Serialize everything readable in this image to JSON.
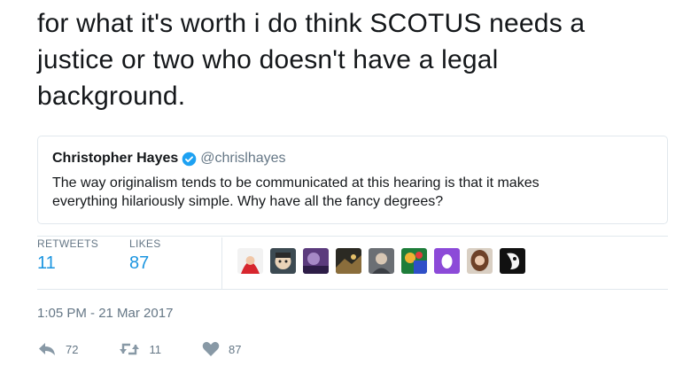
{
  "tweet": {
    "text_lines": [
      "for what it's worth i do think SCOTUS needs a",
      "justice or two who doesn't have a legal",
      "background."
    ]
  },
  "quoted_tweet": {
    "name": "Christopher Hayes",
    "handle": "@chrislhayes",
    "verified_icon": "verified-badge-icon",
    "text_lines": [
      "The way originalism tends to be communicated at this hearing is that it makes",
      "everything hilariously simple. Why have all the fancy degrees?"
    ]
  },
  "stats": {
    "retweets_label": "RETWEETS",
    "retweets_value": "11",
    "likes_label": "LIKES",
    "likes_value": "87"
  },
  "liker_avatars": [
    {
      "icon": "avatar-red-hood"
    },
    {
      "icon": "avatar-cartoon-face"
    },
    {
      "icon": "avatar-purple-tint"
    },
    {
      "icon": "avatar-dark-scene"
    },
    {
      "icon": "avatar-man-gray"
    },
    {
      "icon": "avatar-green-colorful"
    },
    {
      "icon": "avatar-purple-egg"
    },
    {
      "icon": "avatar-woman-brown-hair"
    },
    {
      "icon": "avatar-black-white"
    }
  ],
  "timestamp": "1:05 PM - 21 Mar 2017",
  "actions": {
    "reply_icon": "reply-icon",
    "reply_count": "72",
    "retweet_icon": "retweet-icon",
    "retweet_count": "11",
    "like_icon": "heart-icon",
    "like_count": "87"
  },
  "colors": {
    "accent": "#1b95e0",
    "muted": "#657786",
    "border": "#e1e8ed",
    "text": "#14171a"
  }
}
